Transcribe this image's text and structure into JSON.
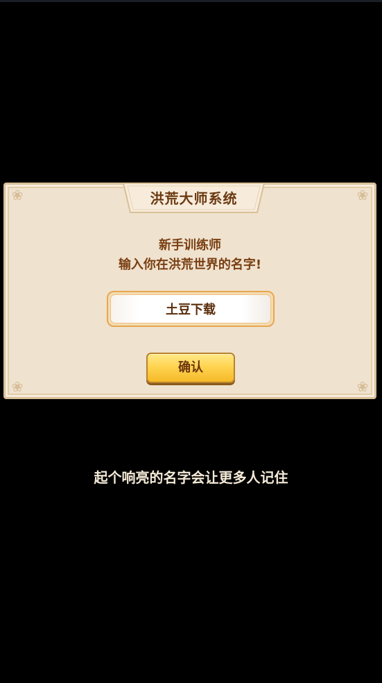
{
  "dialog": {
    "title": "洪荒大师系统",
    "prompt_line1": "新手训练师",
    "prompt_line2": "输入你在洪荒世界的名字!",
    "name_input_value": "土豆下载",
    "confirm_label": "确认"
  },
  "hint": "起个响亮的名字会让更多人记住",
  "colors": {
    "background": "#000000",
    "panel": "#efe2cf",
    "panel_border": "#d9bf98",
    "title_text": "#6b3a12",
    "button_fill": "#ffd451",
    "hint_text": "#f4ead7"
  },
  "icons": {
    "corner_ornament": "cloud-scroll-icon"
  }
}
